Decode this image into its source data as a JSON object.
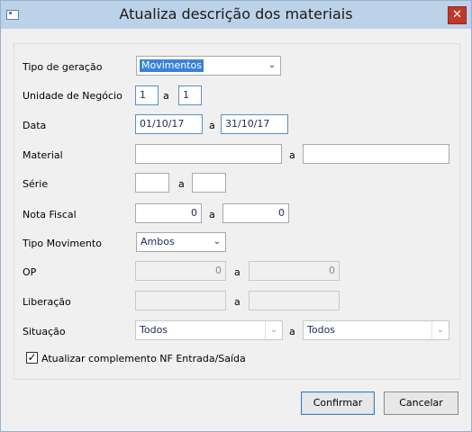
{
  "window": {
    "title": "Atualiza descrição dos materiais",
    "close_glyph": "✕"
  },
  "form": {
    "tipo_geracao": {
      "label": "Tipo de geração",
      "value": "Movimentos"
    },
    "unidade": {
      "label": "Unidade de Negócio",
      "from": "1",
      "sep": "a",
      "to": "1"
    },
    "data": {
      "label": "Data",
      "from": "01/10/17",
      "sep": "a",
      "to": "31/10/17"
    },
    "material": {
      "label": "Material",
      "from": "",
      "sep": "a",
      "to": ""
    },
    "serie": {
      "label": "Série",
      "from": "",
      "sep": "a",
      "to": ""
    },
    "nota_fiscal": {
      "label": "Nota Fiscal",
      "from": "0",
      "sep": "a",
      "to": "0"
    },
    "tipo_movimento": {
      "label": "Tipo Movimento",
      "value": "Ambos"
    },
    "op": {
      "label": "OP",
      "from": "0",
      "sep": "a",
      "to": "0"
    },
    "liberacao": {
      "label": "Liberação",
      "from": "",
      "sep": "a",
      "to": ""
    },
    "situacao": {
      "label": "Situação",
      "from": "Todos",
      "sep": "a",
      "to": "Todos"
    },
    "atualizar_nf": {
      "label": "Atualizar complemento NF Entrada/Saída",
      "checked": true
    }
  },
  "buttons": {
    "confirmar": "Confirmar",
    "cancelar": "Cancelar"
  },
  "icons": {
    "dropdown": "chevron-down-icon",
    "check": "check-icon",
    "app": "window-app-icon"
  }
}
